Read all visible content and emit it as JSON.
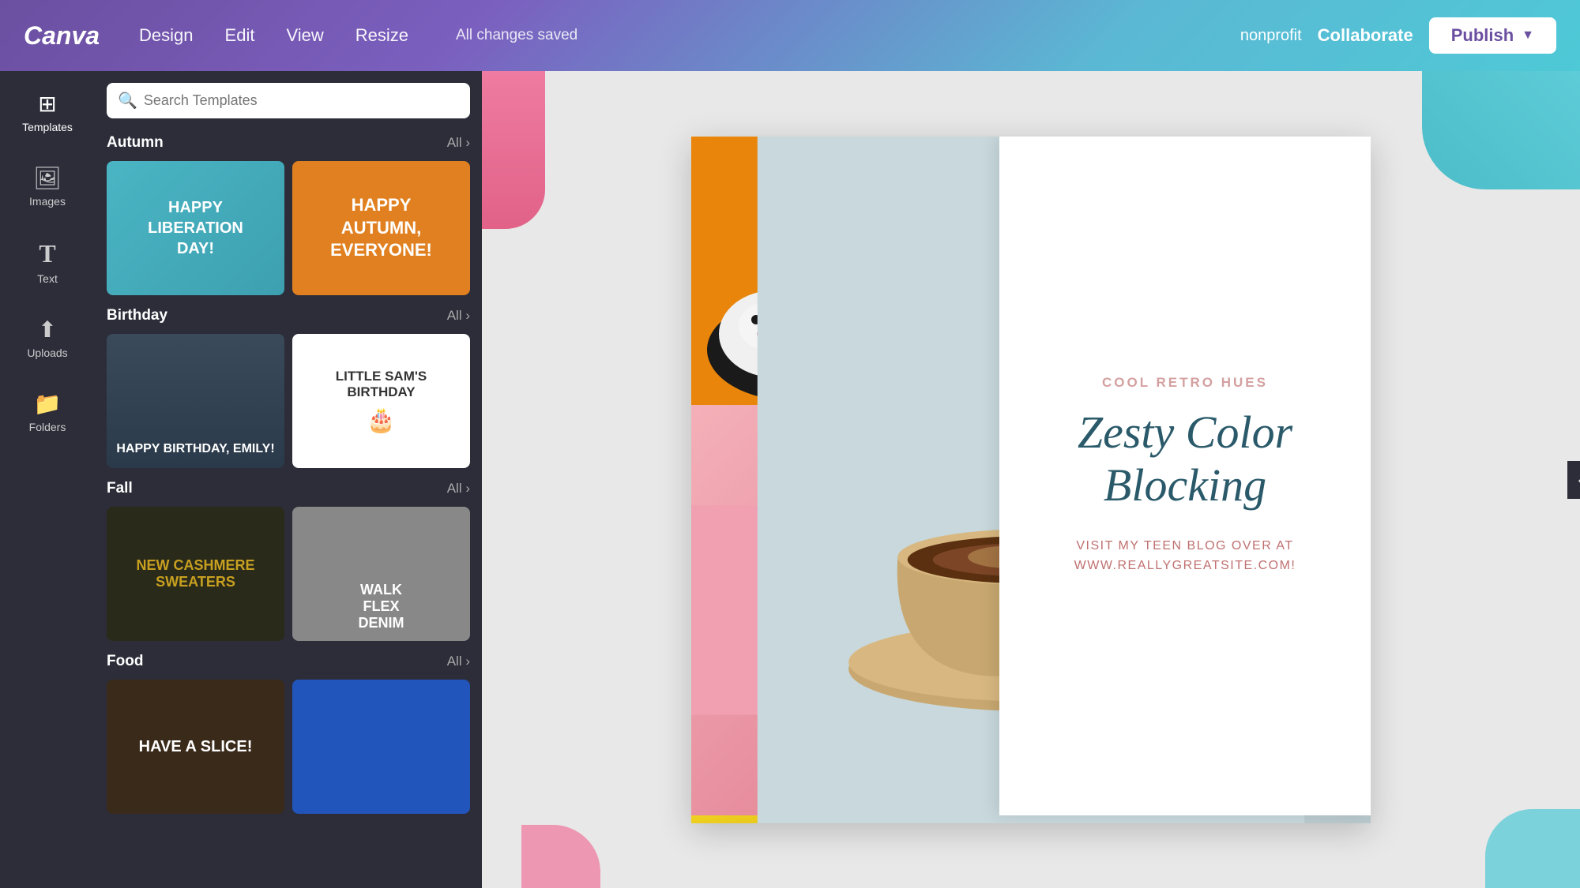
{
  "app": {
    "logo": "Canva",
    "status": "All changes saved"
  },
  "navbar": {
    "design_label": "Design",
    "edit_label": "Edit",
    "view_label": "View",
    "resize_label": "Resize",
    "nonprofit_label": "nonprofit",
    "collaborate_label": "Collaborate",
    "publish_label": "Publish"
  },
  "sidebar": {
    "items": [
      {
        "id": "templates",
        "label": "Templates",
        "icon": "⊞"
      },
      {
        "id": "images",
        "label": "Images",
        "icon": "🖼"
      },
      {
        "id": "text",
        "label": "Text",
        "icon": "T"
      },
      {
        "id": "uploads",
        "label": "Uploads",
        "icon": "⬆"
      },
      {
        "id": "folders",
        "label": "Folders",
        "icon": "📁"
      }
    ]
  },
  "templates_panel": {
    "search_placeholder": "Search Templates",
    "sections": [
      {
        "id": "autumn",
        "title": "Autumn",
        "all_label": "All",
        "cards": [
          {
            "id": "autumn-1",
            "text": "HAPPY LIBERATION DAY!",
            "style": "teal"
          },
          {
            "id": "autumn-2",
            "text": "HAPPY AUTUMN, EVERYONE!",
            "style": "orange"
          }
        ]
      },
      {
        "id": "birthday",
        "title": "Birthday",
        "all_label": "All",
        "cards": [
          {
            "id": "birthday-1",
            "text": "HAPPY BIRTHDAY, EMILY!",
            "style": "dark-photo"
          },
          {
            "id": "birthday-2",
            "text": "LITTLE SAM'S BIRTHDAY",
            "style": "white"
          }
        ]
      },
      {
        "id": "fall",
        "title": "Fall",
        "all_label": "All",
        "cards": [
          {
            "id": "fall-1",
            "text": "NEW CASHMERE SWEATERS",
            "style": "dark-gold"
          },
          {
            "id": "fall-2",
            "text": "WALK FLEX DENIM",
            "style": "gray"
          }
        ]
      },
      {
        "id": "food",
        "title": "Food",
        "all_label": "All",
        "cards": [
          {
            "id": "food-1",
            "text": "HAVE A SLICE!",
            "style": "dark-brown"
          },
          {
            "id": "food-2",
            "text": "",
            "style": "blue"
          }
        ]
      }
    ]
  },
  "canvas": {
    "subtitle": "COOL RETRO HUES",
    "title": "Zesty Color Blocking",
    "description": "VISIT MY TEEN BLOG OVER AT\nWWW.REALLYGREATSITE.COM!"
  }
}
